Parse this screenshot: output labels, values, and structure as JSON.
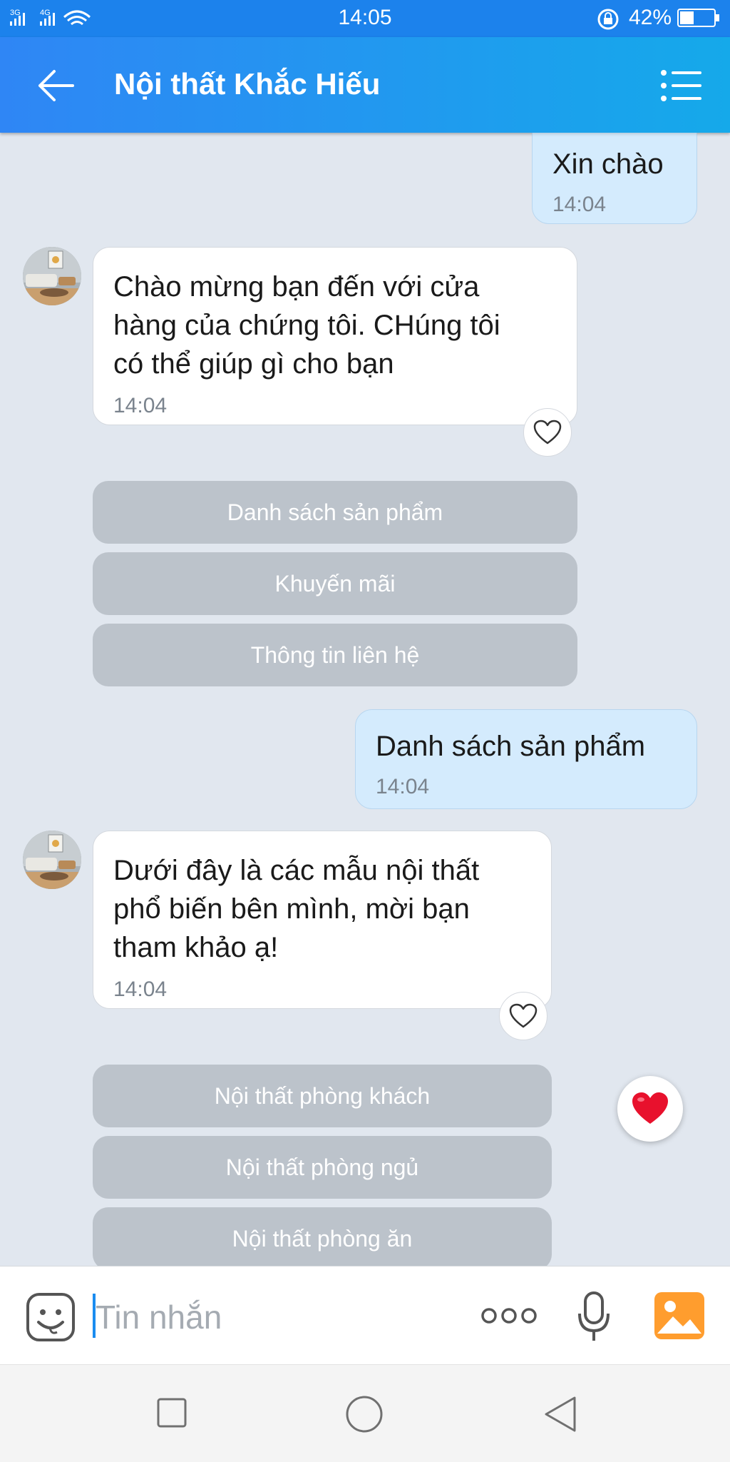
{
  "status_bar": {
    "signal_1": "3G",
    "signal_2": "4G",
    "time": "14:05",
    "battery_percent": "42%",
    "battery_level": 0.42
  },
  "header": {
    "title": "Nội thất Khắc Hiếu",
    "back_icon": "arrow-left-icon",
    "menu_icon": "list-menu-icon"
  },
  "messages": [
    {
      "from": "user",
      "text": "Xin chào",
      "time": "14:04"
    },
    {
      "from": "shop",
      "text": "Chào mừng bạn đến với cửa\nhàng của chứng tôi. CHúng tôi\ncó thể giúp gì cho bạn",
      "time": "14:04"
    },
    {
      "from": "user",
      "text": "Danh sách sản phẩm",
      "time": "14:04"
    },
    {
      "from": "shop",
      "text": "Dưới đây là các mẫu nội thất\nphổ biến bên mình, mời bạn\ntham khảo ạ!",
      "time": "14:04"
    }
  ],
  "quick_replies_1": [
    "Danh sách sản phẩm",
    "Khuyến mãi",
    "Thông tin liên hệ"
  ],
  "quick_replies_2": [
    "Nội thất phòng khách",
    "Nội thất phòng ngủ",
    "Nội thất phòng ăn"
  ],
  "input": {
    "placeholder": "Tin nhắn"
  },
  "colors": {
    "header_start": "#2f86f5",
    "header_end": "#15a9ea",
    "background": "#e1e7ef",
    "outgoing_bubble": "#d4ebfd",
    "quick_reply": "#bcc3cb",
    "heart": "#e8112d"
  }
}
